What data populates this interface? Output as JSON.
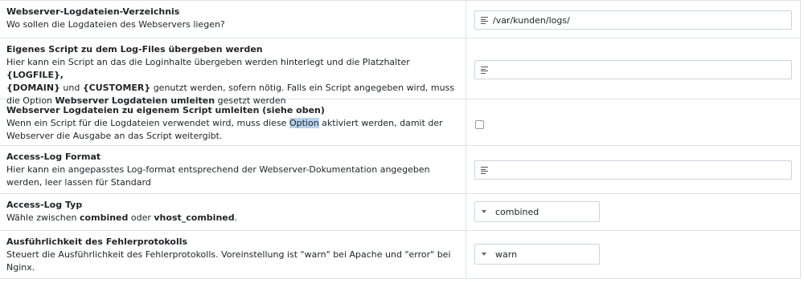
{
  "settings": [
    {
      "title": "Webserver-Logdateien-Verzeichnis",
      "desc": "Wo sollen die Logdateien des Webservers liegen?",
      "control": "text",
      "value": "/var/kunden/logs/"
    },
    {
      "title": "Eigenes Script zu dem Log-Files übergeben werden",
      "desc_1": "Hier kann ein Script an das die Loginhalte übergeben werden hinterlegt und die Platzhalter ",
      "desc_logfile": "{LOGFILE},",
      "desc_domain": "{DOMAIN}",
      "desc_und": " und ",
      "desc_customer": "{CUSTOMER}",
      "desc_2": " genutzt werden, sofern nötig. Falls ein Script angegeben wird, muss die Option ",
      "desc_option_name": "Webserver Logdateien umleiten",
      "desc_3": " gesetzt werden",
      "control": "text",
      "value": ""
    },
    {
      "title": "Webserver Logdateien zu eigenem Script umleiten (siehe oben)",
      "desc_1": "Wenn ein Script für die Logdateien verwendet wird, muss diese ",
      "desc_highlight": "Option",
      "desc_2": " aktiviert werden, damit der Webserver die Ausgabe an das Script weitergibt.",
      "control": "checkbox",
      "checked": false
    },
    {
      "title": "Access-Log Format",
      "desc": "Hier kann ein angepasstes Log-format entsprechend der Webserver-Dokumentation angegeben werden, leer lassen für Standard",
      "control": "text",
      "value": ""
    },
    {
      "title": "Access-Log Typ",
      "desc_1": "Wähle zwischen ",
      "desc_opt1": "combined",
      "desc_oder": " oder ",
      "desc_opt2": "vhost_combined",
      "desc_end": ".",
      "control": "select",
      "value": "combined"
    },
    {
      "title": "Ausführlichkeit des Fehlerprotokolls",
      "desc": "Steuert die Ausführlichkeit des Fehlerprotokolls. Voreinstellung ist \"warn\" bei Apache und \"error\" bei Nginx.",
      "control": "select",
      "value": "warn"
    }
  ]
}
